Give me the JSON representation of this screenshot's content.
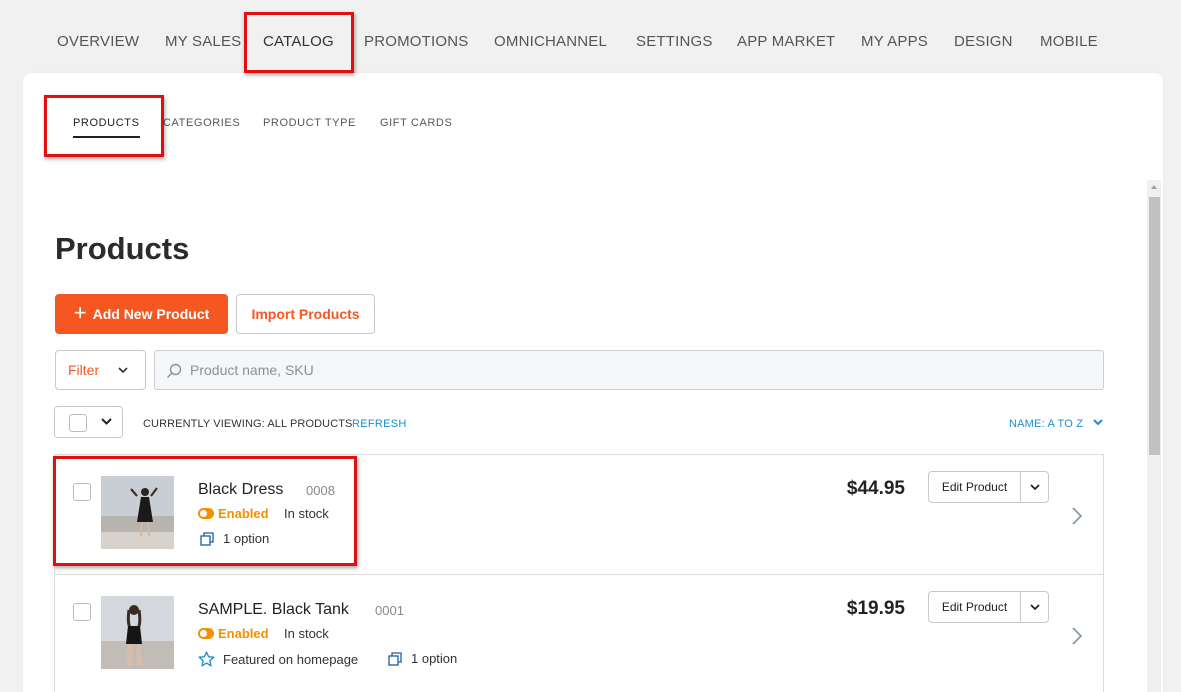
{
  "topnav": {
    "items": [
      "OVERVIEW",
      "MY SALES",
      "CATALOG",
      "PROMOTIONS",
      "OMNICHANNEL",
      "SETTINGS",
      "APP MARKET",
      "MY APPS",
      "DESIGN",
      "MOBILE"
    ],
    "active": "CATALOG"
  },
  "subnav": {
    "items": [
      "PRODUCTS",
      "CATEGORIES",
      "PRODUCT TYPE",
      "GIFT CARDS"
    ],
    "active": "PRODUCTS"
  },
  "page": {
    "title": "Products",
    "add_button": "Add New Product",
    "import_button": "Import Products",
    "filter_label": "Filter",
    "search_placeholder": "Product name, SKU",
    "viewing_text": "CURRENTLY VIEWING: ALL PRODUCTS",
    "refresh_label": "REFRESH",
    "sort_label": "NAME: A TO Z"
  },
  "products": [
    {
      "name": "Black Dress",
      "sku": "0008",
      "status": "Enabled",
      "stock": "In stock",
      "options": "1 option",
      "featured": "",
      "price": "$44.95",
      "edit_label": "Edit Product"
    },
    {
      "name": "SAMPLE. Black Tank",
      "sku": "0001",
      "status": "Enabled",
      "stock": "In stock",
      "options": "1 option",
      "featured": "Featured on homepage",
      "price": "$19.95",
      "edit_label": "Edit Product"
    }
  ],
  "colors": {
    "accent": "#f55722",
    "status_enabled": "#f29100",
    "link": "#1a8fd1",
    "highlight_box": "#e01010"
  }
}
